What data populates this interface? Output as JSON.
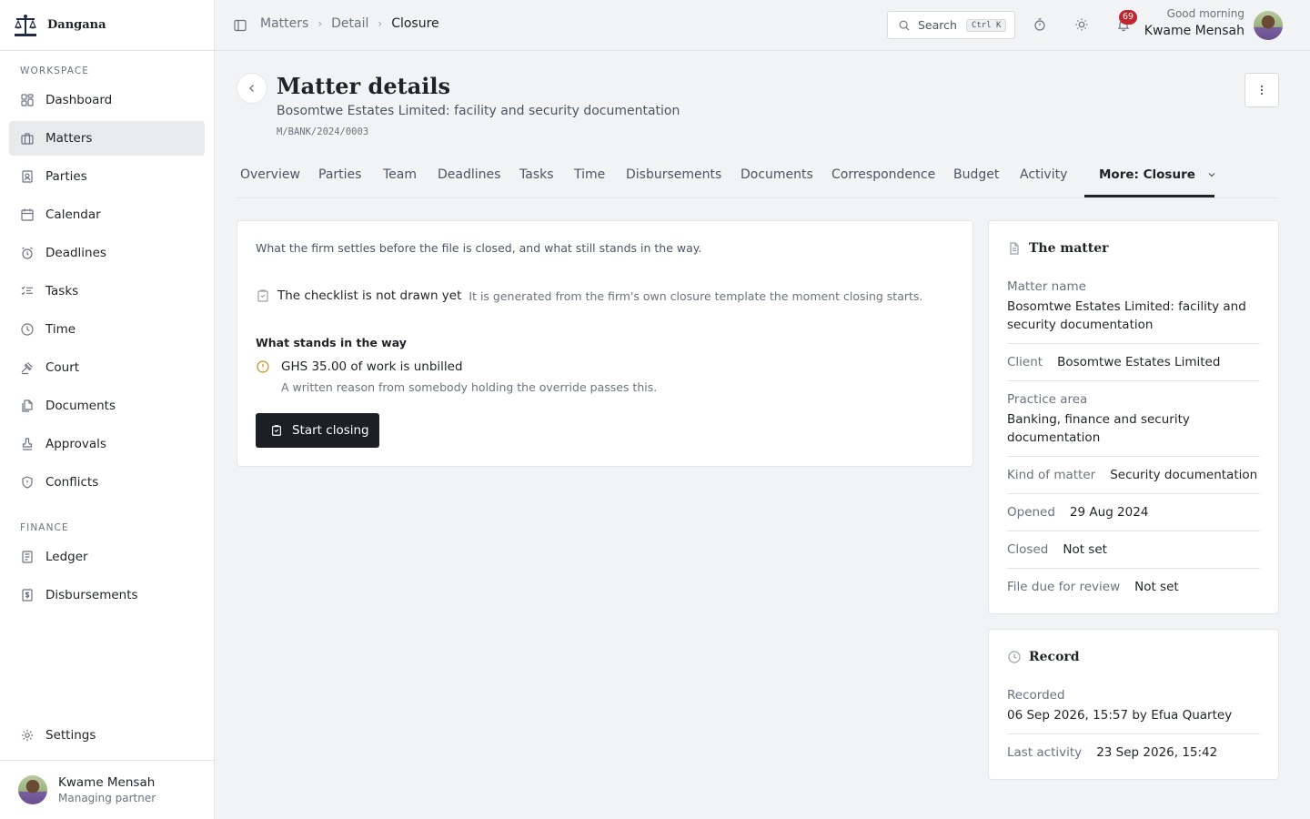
{
  "brand": {
    "name": "Dangana"
  },
  "sidebar": {
    "workspace_label": "WORKSPACE",
    "items": [
      {
        "label": "Dashboard",
        "icon": "dashboard-icon"
      },
      {
        "label": "Matters",
        "icon": "briefcase-icon",
        "active": true
      },
      {
        "label": "Parties",
        "icon": "contact-card-icon"
      },
      {
        "label": "Calendar",
        "icon": "calendar-icon"
      },
      {
        "label": "Deadlines",
        "icon": "alarm-clock-icon"
      },
      {
        "label": "Tasks",
        "icon": "checklist-icon"
      },
      {
        "label": "Time",
        "icon": "clock-icon"
      },
      {
        "label": "Court",
        "icon": "gavel-icon"
      },
      {
        "label": "Documents",
        "icon": "documents-icon"
      },
      {
        "label": "Approvals",
        "icon": "stamp-icon"
      },
      {
        "label": "Conflicts",
        "icon": "shield-icon"
      }
    ],
    "finance_label": "FINANCE",
    "finance_items": [
      {
        "label": "Ledger",
        "icon": "ledger-icon"
      },
      {
        "label": "Disbursements",
        "icon": "receipt-icon"
      }
    ],
    "settings_label": "Settings",
    "user": {
      "name": "Kwame Mensah",
      "role": "Managing partner"
    }
  },
  "topbar": {
    "breadcrumbs": [
      "Matters",
      "Detail",
      "Closure"
    ],
    "search_label": "Search",
    "search_shortcut": "Ctrl K",
    "notifications_count": "69",
    "greeting": "Good morning",
    "user_name": "Kwame Mensah"
  },
  "header": {
    "title": "Matter details",
    "subtitle": "Bosomtwe Estates Limited: facility and security documentation",
    "reference": "M/BANK/2024/0003"
  },
  "tabs": [
    {
      "label": "Overview"
    },
    {
      "label": "Parties"
    },
    {
      "label": "Team"
    },
    {
      "label": "Deadlines"
    },
    {
      "label": "Tasks"
    },
    {
      "label": "Time"
    },
    {
      "label": "Disbursements"
    },
    {
      "label": "Documents"
    },
    {
      "label": "Correspondence"
    },
    {
      "label": "Budget"
    },
    {
      "label": "Activity"
    },
    {
      "label": "More: Closure",
      "active": true
    }
  ],
  "closure": {
    "intro": "What the firm settles before the file is closed, and what still stands in the way.",
    "checklist_title": "The checklist is not drawn yet",
    "checklist_desc": "It is generated from the firm's own closure template the moment closing starts.",
    "stands_heading": "What stands in the way",
    "blocker_title": "GHS 35.00 of work is unbilled",
    "blocker_note": "A written reason from somebody holding the override passes this.",
    "start_button": "Start closing"
  },
  "matter_card": {
    "title": "The matter",
    "fields": {
      "matter_name_label": "Matter name",
      "matter_name": "Bosomtwe Estates Limited: facility and security documentation",
      "client_label": "Client",
      "client": "Bosomtwe Estates Limited",
      "practice_area_label": "Practice area",
      "practice_area": "Banking, finance and security documentation",
      "kind_label": "Kind of matter",
      "kind": "Security documentation",
      "opened_label": "Opened",
      "opened": "29 Aug 2024",
      "closed_label": "Closed",
      "closed": "Not set",
      "review_label": "File due for review",
      "review": "Not set"
    }
  },
  "record_card": {
    "title": "Record",
    "recorded_label": "Recorded",
    "recorded": "06 Sep 2026, 15:57 by Efua Quartey",
    "last_activity_label": "Last activity",
    "last_activity": "23 Sep 2026, 15:42"
  },
  "colors": {
    "primary": "#1c2024",
    "badge": "#c0262d",
    "warning": "#c98a1b",
    "active_nav": "#e9eaec"
  }
}
